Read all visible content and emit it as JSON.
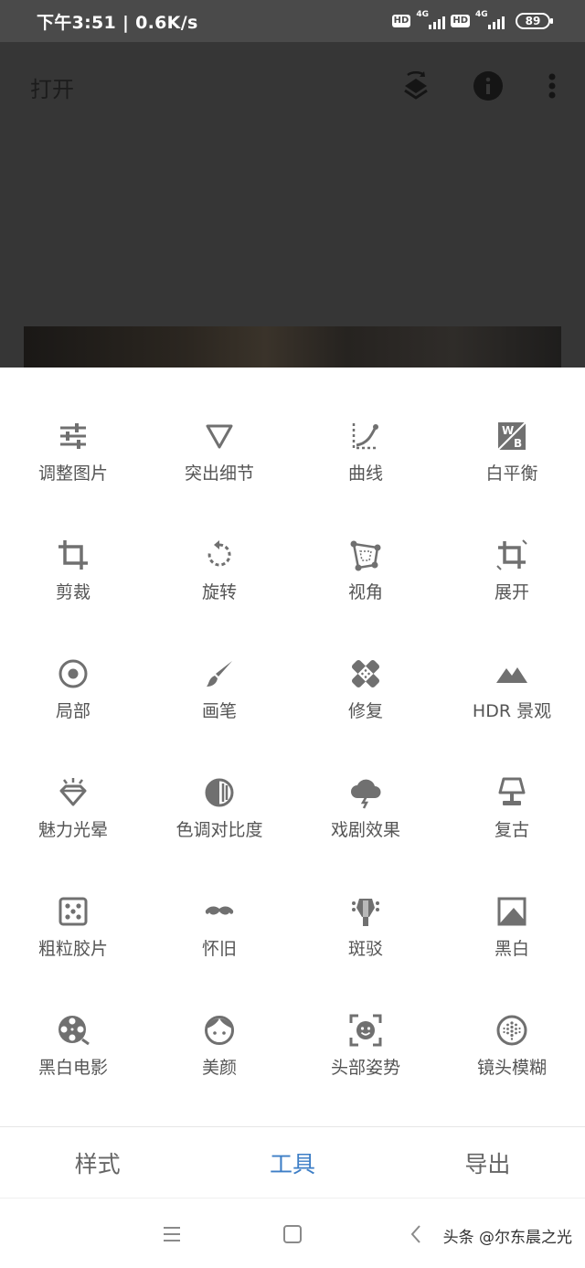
{
  "status_bar": {
    "time_speed": "下午3:51 | 0.6K/s",
    "hd1": "HD",
    "net1": "4G",
    "hd2": "HD",
    "net2": "4G",
    "battery": "89"
  },
  "app_bar": {
    "title": "打开",
    "icons": [
      "layers-refresh-icon",
      "info-icon",
      "more-vert-icon"
    ]
  },
  "tools": [
    {
      "label": "调整图片",
      "icon": "tune-sliders-icon"
    },
    {
      "label": "突出细节",
      "icon": "triangle-down-icon"
    },
    {
      "label": "曲线",
      "icon": "curves-icon"
    },
    {
      "label": "白平衡",
      "icon": "white-balance-icon"
    },
    {
      "label": "剪裁",
      "icon": "crop-icon"
    },
    {
      "label": "旋转",
      "icon": "rotate-icon"
    },
    {
      "label": "视角",
      "icon": "perspective-icon"
    },
    {
      "label": "展开",
      "icon": "expand-crop-icon"
    },
    {
      "label": "局部",
      "icon": "target-icon"
    },
    {
      "label": "画笔",
      "icon": "brush-icon"
    },
    {
      "label": "修复",
      "icon": "healing-bandage-icon"
    },
    {
      "label": "HDR 景观",
      "icon": "mountains-icon"
    },
    {
      "label": "魅力光晕",
      "icon": "diamond-glow-icon"
    },
    {
      "label": "色调对比度",
      "icon": "tonal-contrast-icon"
    },
    {
      "label": "戏剧效果",
      "icon": "storm-cloud-icon"
    },
    {
      "label": "复古",
      "icon": "lamp-icon"
    },
    {
      "label": "粗粒胶片",
      "icon": "dice-icon"
    },
    {
      "label": "怀旧",
      "icon": "mustache-icon"
    },
    {
      "label": "斑驳",
      "icon": "guitar-head-icon"
    },
    {
      "label": "黑白",
      "icon": "black-white-image-icon"
    },
    {
      "label": "黑白电影",
      "icon": "film-reel-icon"
    },
    {
      "label": "美颜",
      "icon": "face-icon"
    },
    {
      "label": "头部姿势",
      "icon": "face-frame-icon"
    },
    {
      "label": "镜头模糊",
      "icon": "lens-blur-icon"
    }
  ],
  "bottom_tabs": [
    {
      "label": "样式",
      "active": false
    },
    {
      "label": "工具",
      "active": true
    },
    {
      "label": "导出",
      "active": false
    }
  ],
  "colors": {
    "accent": "#3d7ec6",
    "icon": "#707070",
    "overlay": "#363636"
  },
  "watermark": "头条 @尔东晨之光"
}
